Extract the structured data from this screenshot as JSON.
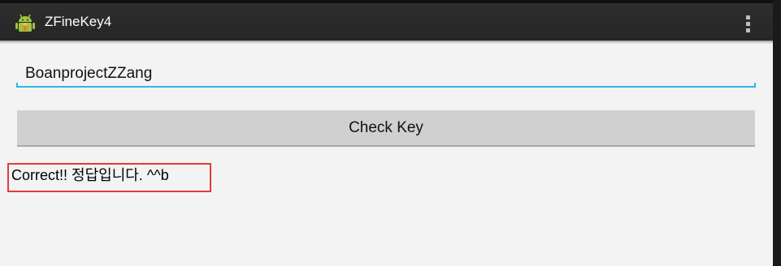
{
  "app": {
    "title": "ZFineKey4",
    "icon": "android-robot-icon",
    "overflow_icon": "overflow-menu-icon"
  },
  "key_field": {
    "value": "BoanprojectZZang"
  },
  "check_button": {
    "label": "Check Key"
  },
  "result": {
    "text": "Correct!! 정답입니다. ^^b"
  },
  "colors": {
    "action_bar": "#2b2b2b",
    "accent": "#33b5e5",
    "highlight": "#e33b3b",
    "background": "#f3f3f3"
  }
}
